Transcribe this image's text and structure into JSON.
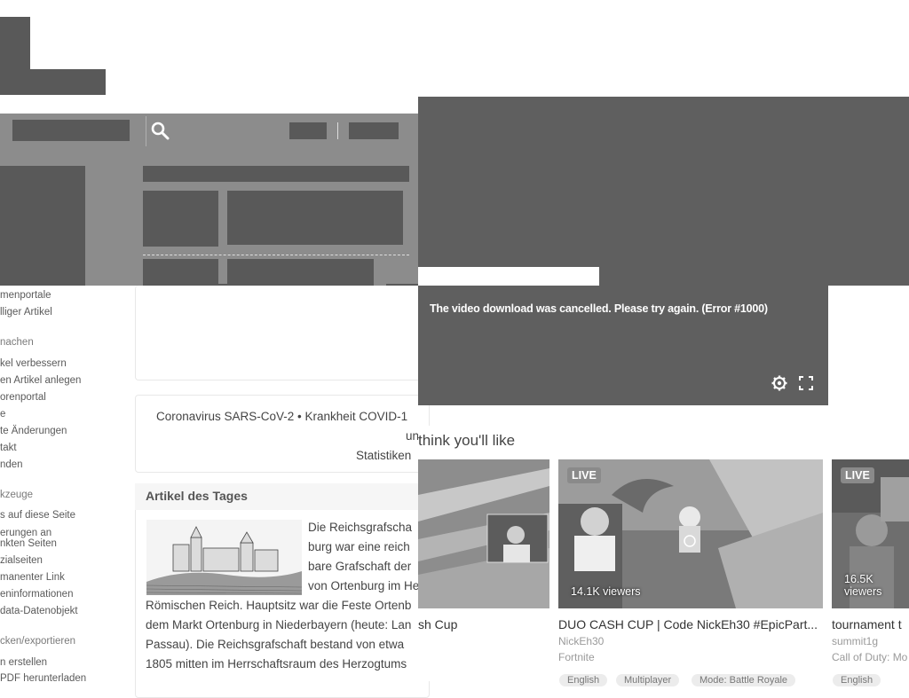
{
  "wiki": {
    "sidebar_links_1": [
      "menportale",
      "lliger Artikel"
    ],
    "sidebar_head_1": "nachen",
    "sidebar_links_2": [
      "kel verbessern",
      "en Artikel anlegen",
      "orenportal",
      "e",
      "te Änderungen",
      "takt",
      "nden"
    ],
    "sidebar_head_2": "kzeuge",
    "sidebar_links_3": [
      "s auf diese Seite",
      "erungen an",
      "nkten Seiten",
      "zialseiten",
      "manenter Link",
      "eninformationen",
      "data-Datenobjekt"
    ],
    "sidebar_head_3": "cken/exportieren",
    "sidebar_links_4": [
      "n erstellen",
      "PDF herunterladen"
    ],
    "covid_line": "Coronavirus SARS-CoV-2 • Krankheit COVID-1",
    "covid_line2": "un",
    "stats_link": "Statistiken",
    "article_heading": "Artikel des Tages",
    "article_lines": [
      "Die Reichsgrafscha",
      "burg war eine reich",
      "bare Grafschaft der",
      "von Ortenburg im He",
      "Römischen Reich. Hauptsitz war die Feste Ortenb",
      "dem Markt Ortenburg in Niederbayern (heute: Lan",
      "Passau). Die Reichsgrafschaft bestand von etwa",
      "1805 mitten im Herrschaftsraum des Herzogtums"
    ]
  },
  "player": {
    "error_message": "The video download was cancelled. Please try again. (Error #1000)",
    "settings_icon": "gear-icon",
    "fullscreen_icon": "fullscreen-icon"
  },
  "recommendations": {
    "heading": "think you'll like",
    "cards": [
      {
        "title": "sh Cup",
        "channel": "",
        "game": "",
        "viewers": "",
        "live": false,
        "tags": []
      },
      {
        "title": "DUO CASH CUP | Code NickEh30 #EpicPart...",
        "channel": "NickEh30",
        "game": "Fortnite",
        "viewers": "14.1K viewers",
        "live": true,
        "live_label": "LIVE",
        "tags": [
          "English",
          "Multiplayer",
          "Mode: Battle Royale"
        ]
      },
      {
        "title": "tournament t",
        "channel": "summit1g",
        "game": "Call of Duty: Mo",
        "viewers": "16.5K viewers",
        "live": true,
        "live_label": "LIVE",
        "tags": [
          "English"
        ]
      }
    ]
  },
  "colors": {
    "redaction": "#595959",
    "player_bg": "#5f5f5f",
    "wiki_bar": "#8c8c8c"
  }
}
